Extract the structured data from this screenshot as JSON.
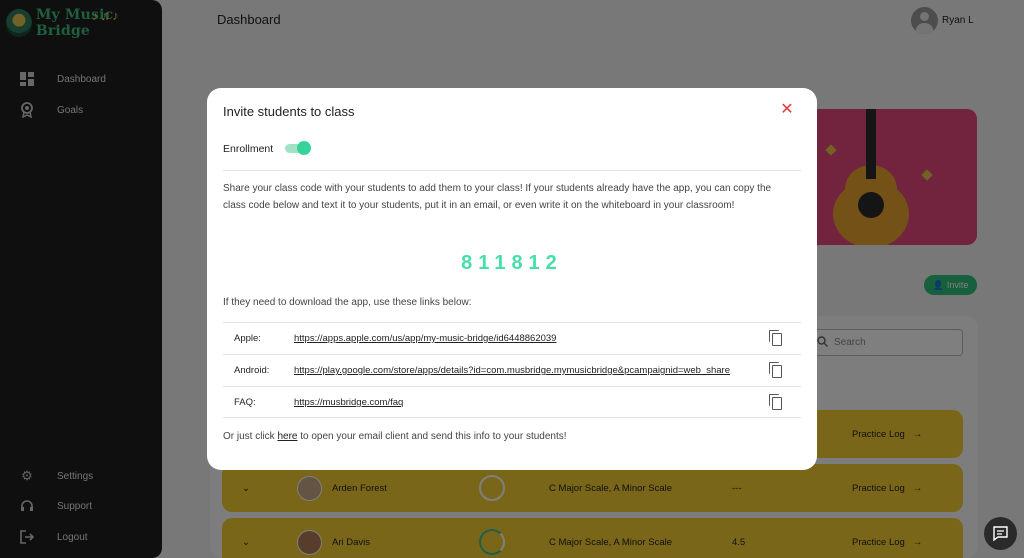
{
  "app": {
    "name": "My Music Bridge"
  },
  "sidebar": {
    "top_items": [
      {
        "label": "Dashboard",
        "icon": "dashboard-icon"
      },
      {
        "label": "Goals",
        "icon": "award-icon"
      }
    ],
    "bottom_items": [
      {
        "label": "Settings",
        "icon": "gear-icon"
      },
      {
        "label": "Support",
        "icon": "headset-icon"
      },
      {
        "label": "Logout",
        "icon": "logout-icon"
      }
    ]
  },
  "header": {
    "title": "Dashboard",
    "user_name": "Ryan L"
  },
  "background": {
    "invite_label": "Invite",
    "search_placeholder": "Search",
    "rows": [
      {
        "name": "",
        "scales": "",
        "score": "",
        "action": "Practice Log"
      },
      {
        "name": "Arden Forest",
        "scales": "C Major Scale, A Minor Scale",
        "score": "---",
        "action": "Practice Log"
      },
      {
        "name": "Ari Davis",
        "scales": "C Major Scale, A Minor Scale",
        "score": "4.5",
        "action": "Practice Log"
      }
    ]
  },
  "modal": {
    "title": "Invite students to class",
    "enrollment_label": "Enrollment",
    "enrollment_on": true,
    "description": "Share your class code with your students to add them to your class! If your students already have the app, you can copy the class code below and text it to your students, put it in an email, or even write it on the whiteboard in your classroom!",
    "class_code": "811812",
    "links_intro": "If they need to download the app, use these links below:",
    "links": [
      {
        "label": "Apple:",
        "url": "https://apps.apple.com/us/app/my-music-bridge/id6448862039"
      },
      {
        "label": "Android:",
        "url": "https://play.google.com/store/apps/details?id=com.musbridge.mymusicbridge&pcampaignid=web_share"
      },
      {
        "label": "FAQ:",
        "url": "https://musbridge.com/faq"
      }
    ],
    "footer_prefix": "Or just click",
    "footer_link": "here",
    "footer_suffix": "to open your email client and send this info to your students!"
  },
  "colors": {
    "accent": "#37d39a",
    "close": "#e03a3a",
    "row": "#f2cd33",
    "sidebar": "#1f1f1f",
    "banner": "#e4467a"
  }
}
